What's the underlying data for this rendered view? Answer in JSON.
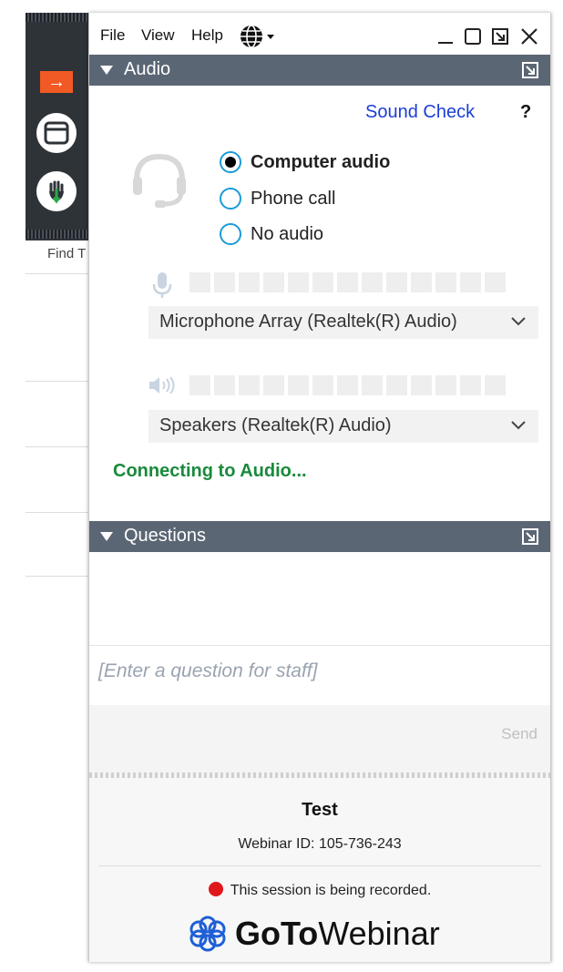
{
  "app": {
    "menu": [
      "File",
      "View",
      "Help"
    ],
    "language_icon": "globe-icon"
  },
  "background": {
    "find_label": "Find T"
  },
  "audio": {
    "header": "Audio",
    "sound_check": "Sound Check",
    "help": "?",
    "options": [
      {
        "label": "Computer audio",
        "selected": true
      },
      {
        "label": "Phone call",
        "selected": false
      },
      {
        "label": "No audio",
        "selected": false
      }
    ],
    "microphone": "Microphone Array (Realtek(R) Audio)",
    "speakers": "Speakers (Realtek(R) Audio)",
    "status": "Connecting to Audio...",
    "status_color": "#1a8a3c"
  },
  "questions": {
    "header": "Questions",
    "placeholder": "[Enter a question for staff]",
    "send": "Send"
  },
  "session": {
    "title": "Test",
    "webinar_id": "Webinar ID: 105-736-243",
    "recording": "This session is being recorded.",
    "brand_bold": "GoTo",
    "brand_light": "Webinar"
  },
  "colors": {
    "header_bg": "#5b6675",
    "accent_orange": "#f15a24",
    "link_blue": "#1a3fd6",
    "radio_blue": "#1b9bd7",
    "record_red": "#e0181b"
  }
}
